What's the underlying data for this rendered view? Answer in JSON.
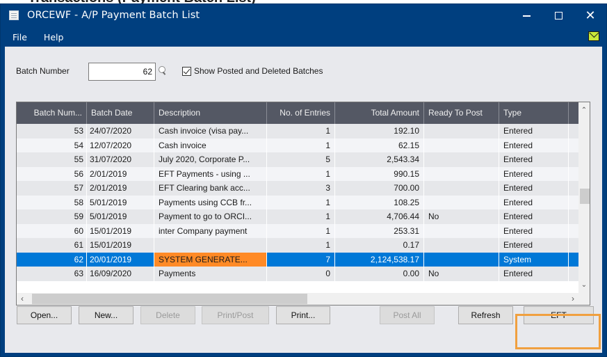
{
  "caption": "Transactions (Payment Batch List)",
  "window": {
    "title": "ORCEWF - A/P Payment Batch List",
    "controls": {
      "minimize": "minimize",
      "maximize": "maximize",
      "close": "✕"
    }
  },
  "menu": {
    "items": [
      "File",
      "Help"
    ],
    "mail_icon": "mail-icon"
  },
  "filter": {
    "batch_number_label": "Batch Number",
    "batch_number_value": "62",
    "show_posted_label": "Show Posted and Deleted Batches",
    "show_posted_checked": true
  },
  "grid": {
    "columns": [
      "Batch Num...",
      "Batch Date",
      "Description",
      "No. of Entries",
      "Total Amount",
      "Ready To Post",
      "Type"
    ],
    "rows": [
      {
        "batch": "53",
        "date": "24/07/2020",
        "description": "Cash invoice (visa pay...",
        "entries": "1",
        "amount": "192.10",
        "ready": "",
        "type": "Entered"
      },
      {
        "batch": "54",
        "date": "12/07/2020",
        "description": "Cash invoice",
        "entries": "1",
        "amount": "62.15",
        "ready": "",
        "type": "Entered"
      },
      {
        "batch": "55",
        "date": "31/07/2020",
        "description": "July 2020, Corporate P...",
        "entries": "5",
        "amount": "2,543.34",
        "ready": "",
        "type": "Entered"
      },
      {
        "batch": "56",
        "date": "2/01/2019",
        "description": "EFT Payments - using ...",
        "entries": "1",
        "amount": "990.15",
        "ready": "",
        "type": "Entered"
      },
      {
        "batch": "57",
        "date": "2/01/2019",
        "description": "EFT Clearing bank acc...",
        "entries": "3",
        "amount": "700.00",
        "ready": "",
        "type": "Entered"
      },
      {
        "batch": "58",
        "date": "5/01/2019",
        "description": "Payments using CCB fr...",
        "entries": "1",
        "amount": "108.25",
        "ready": "",
        "type": "Entered"
      },
      {
        "batch": "59",
        "date": "5/01/2019",
        "description": "Payment to go to ORCI...",
        "entries": "1",
        "amount": "4,706.44",
        "ready": "No",
        "type": "Entered"
      },
      {
        "batch": "60",
        "date": "15/01/2019",
        "description": "inter Company payment",
        "entries": "1",
        "amount": "253.31",
        "ready": "",
        "type": "Entered"
      },
      {
        "batch": "61",
        "date": "15/01/2019",
        "description": "",
        "entries": "1",
        "amount": "0.17",
        "ready": "",
        "type": "Entered"
      },
      {
        "batch": "62",
        "date": "20/01/2019",
        "description": "SYSTEM GENERATE...",
        "entries": "7",
        "amount": "2,124,538.17",
        "ready": "",
        "type": "System"
      },
      {
        "batch": "63",
        "date": "16/09/2020",
        "description": "Payments",
        "entries": "0",
        "amount": "0.00",
        "ready": "No",
        "type": "Entered"
      }
    ],
    "selected_index": 9,
    "highlight_color": "#ff8a26",
    "selection_color": "#0078d7"
  },
  "buttons": {
    "open": "Open...",
    "new": "New...",
    "delete": "Delete",
    "print_post": "Print/Post",
    "print": "Print...",
    "post_all": "Post All",
    "refresh": "Refresh",
    "eft": "EFT"
  },
  "colors": {
    "titlebar": "#003f7f",
    "client_bg": "#e8e9ed",
    "grid_header": "#545864",
    "eft_highlight": "#f0a03f"
  }
}
